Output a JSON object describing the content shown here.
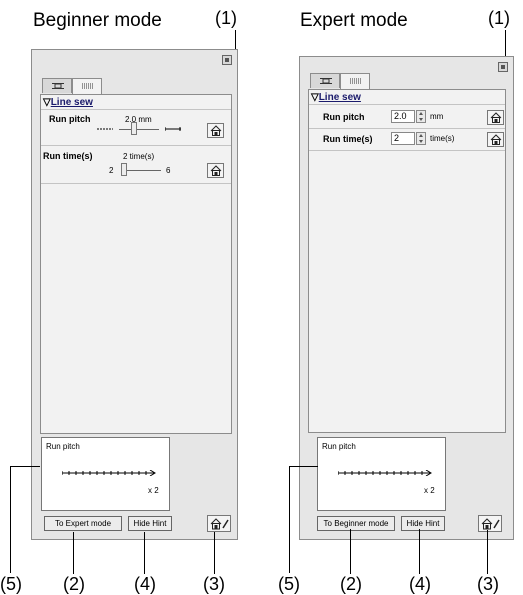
{
  "left": {
    "caption": "Beginner mode",
    "callout_top": "(1)",
    "section_title": "Line sew",
    "run_pitch": {
      "label": "Run pitch",
      "value": "2.0 mm",
      "slider_level": 0.35
    },
    "run_times": {
      "label": "Run time(s)",
      "value": "2 time(s)",
      "min": "2",
      "max": "6",
      "slider_level": 0.0
    },
    "hint_title": "Run pitch",
    "hint_multiplier": "x 2",
    "mode_button": "To Expert mode",
    "hint_button": "Hide Hint",
    "callouts_bottom": [
      "(5)",
      "(2)",
      "(4)",
      "(3)"
    ]
  },
  "right": {
    "caption": "Expert mode",
    "callout_top": "(1)",
    "section_title": "Line sew",
    "run_pitch": {
      "label": "Run pitch",
      "value": "2.0",
      "unit": "mm"
    },
    "run_times": {
      "label": "Run time(s)",
      "value": "2",
      "unit": "time(s)"
    },
    "hint_title": "Run pitch",
    "hint_multiplier": "x 2",
    "mode_button": "To Beginner mode",
    "hint_button": "Hide Hint",
    "callouts_bottom": [
      "(5)",
      "(2)",
      "(4)",
      "(3)"
    ]
  },
  "icons": {
    "section_toggle": "▽",
    "home": "house-icon",
    "home_settings": "house-settings-icon",
    "close": "close-icon"
  }
}
